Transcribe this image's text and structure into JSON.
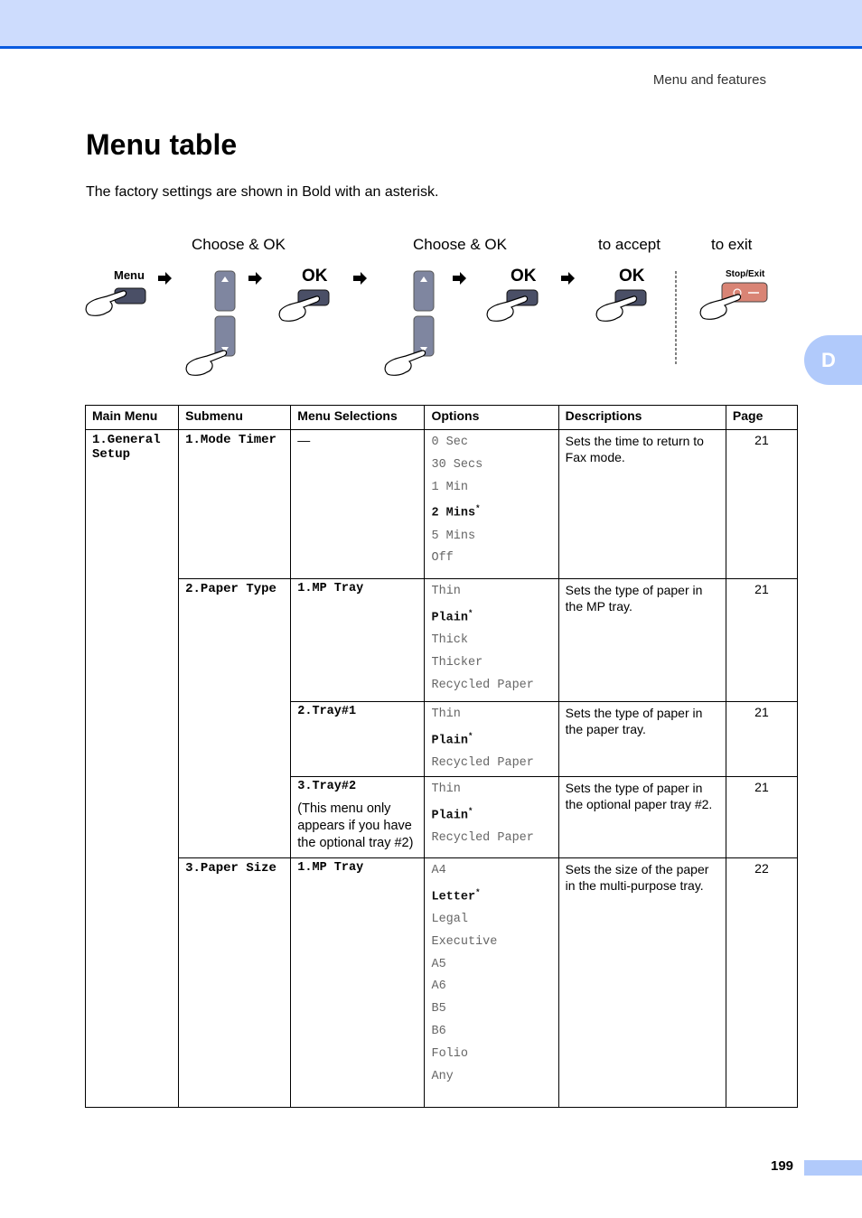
{
  "header": {
    "running_head": "Menu and features"
  },
  "page": {
    "title": "Menu table",
    "intro": "The factory settings are shown in Bold with an asterisk.",
    "chapter_tab": "D",
    "page_number": "199"
  },
  "diagram": {
    "step_labels": [
      "Choose & OK",
      "Choose & OK",
      "to accept",
      "to exit"
    ],
    "buttons": {
      "menu": "Menu",
      "ok": "OK",
      "stop_exit": "Stop/Exit"
    },
    "colors": {
      "button": "#4a4f66",
      "arrow_button": "#7f86a0",
      "stop_button": "#d98475"
    }
  },
  "table": {
    "headers": [
      "Main Menu",
      "Submenu",
      "Menu Selections",
      "Options",
      "Descriptions",
      "Page"
    ],
    "main_menu": "1.General Setup",
    "rows": [
      {
        "submenu": "1.Mode Timer",
        "selection": "—",
        "note": "",
        "options": [
          {
            "label": "0 Sec"
          },
          {
            "label": "30 Secs"
          },
          {
            "label": "1 Min"
          },
          {
            "label": "2 Mins",
            "default": true
          },
          {
            "label": "5 Mins"
          },
          {
            "label": "Off"
          }
        ],
        "description": "Sets the time to return to Fax mode.",
        "page": "21"
      },
      {
        "submenu": "2.Paper Type",
        "selection": "1.MP Tray",
        "note": "",
        "options": [
          {
            "label": "Thin"
          },
          {
            "label": "Plain",
            "default": true
          },
          {
            "label": "Thick"
          },
          {
            "label": "Thicker"
          },
          {
            "label": "Recycled Paper"
          }
        ],
        "description": "Sets the type of paper in the MP tray.",
        "page": "21"
      },
      {
        "submenu": "",
        "selection": "2.Tray#1",
        "note": "",
        "options": [
          {
            "label": "Thin"
          },
          {
            "label": "Plain",
            "default": true
          },
          {
            "label": "Recycled Paper"
          }
        ],
        "description": "Sets the type of paper in the paper tray.",
        "page": "21"
      },
      {
        "submenu": "",
        "selection": "3.Tray#2",
        "note": "(This menu only appears if you have the optional tray #2)",
        "options": [
          {
            "label": "Thin"
          },
          {
            "label": "Plain",
            "default": true
          },
          {
            "label": "Recycled Paper"
          }
        ],
        "description": "Sets the type of paper in the optional paper tray #2.",
        "page": "21"
      },
      {
        "submenu": "3.Paper Size",
        "selection": "1.MP Tray",
        "note": "",
        "options": [
          {
            "label": "A4"
          },
          {
            "label": "Letter",
            "default": true
          },
          {
            "label": "Legal"
          },
          {
            "label": "Executive"
          },
          {
            "label": "A5"
          },
          {
            "label": "A6"
          },
          {
            "label": "B5"
          },
          {
            "label": "B6"
          },
          {
            "label": "Folio"
          },
          {
            "label": "Any"
          }
        ],
        "description": "Sets the size of the paper in the multi-purpose tray.",
        "page": "22"
      }
    ]
  }
}
